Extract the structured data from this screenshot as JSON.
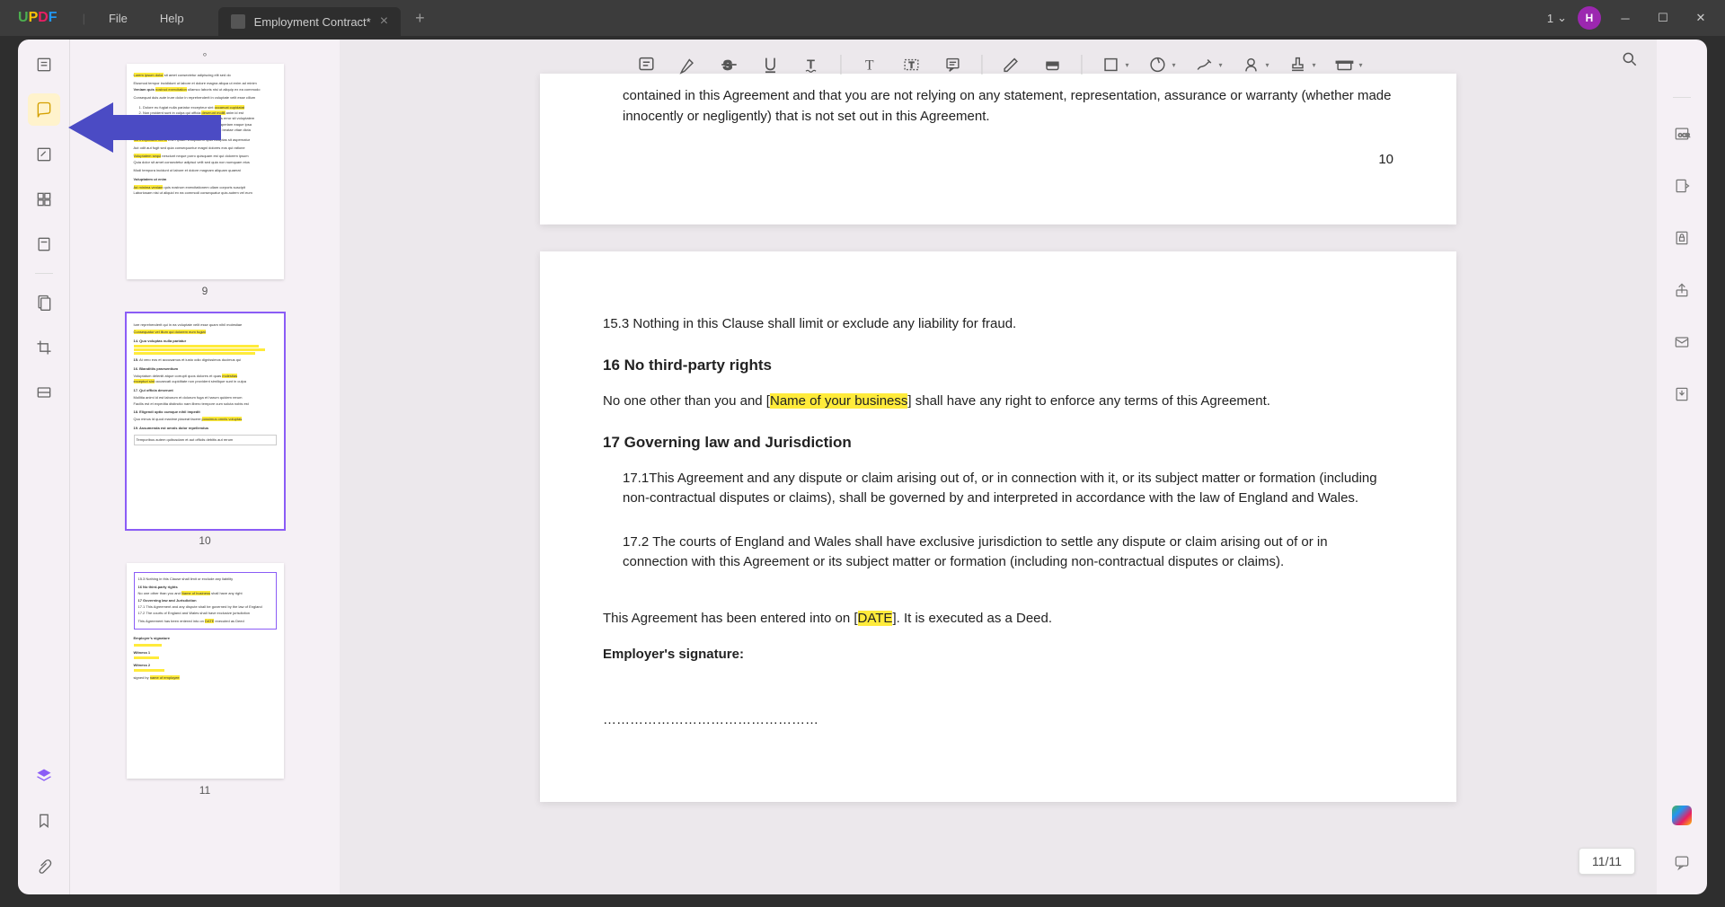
{
  "app": {
    "logo_u": "U",
    "logo_p": "P",
    "logo_d": "D",
    "logo_f": "F"
  },
  "menu": {
    "file": "File",
    "help": "Help"
  },
  "tab": {
    "title": "Employment Contract*",
    "close": "×",
    "add": "+"
  },
  "window": {
    "notif": "1",
    "avatar": "H"
  },
  "thumbs": {
    "p9": "9",
    "p10": "10",
    "p11": "11"
  },
  "page_indicator": "11/11",
  "doc": {
    "p10_frag1": "contained in this Agreement and that you are not relying on any statement, representation, assurance or warranty (whether made innocently or negligently) that is not set out in this Agreement.",
    "p10_num": "10",
    "c153": "15.3   Nothing in this Clause shall limit or exclude any liability for fraud.",
    "h16": "16   No third-party rights",
    "c16_a": "No one other than you and [",
    "c16_hl": "Name of your business",
    "c16_b": "] shall have any right to enforce any terms of this Agreement.",
    "h17": "17   Governing law and Jurisdiction",
    "c171": "17.1This Agreement and any dispute or claim arising out of, or in connection with it, or its subject matter or formation (including non-contractual disputes or claims), shall be governed by and interpreted in accordance with the law of England and Wales.",
    "c172": "17.2 The courts of England and Wales shall have exclusive jurisdiction to settle any dispute or claim arising out of or in connection with this Agreement or its subject matter or formation (including non-contractual disputes or claims).",
    "entered_a": "This Agreement has been entered into on [",
    "entered_hl": "DATE",
    "entered_b": "]. It is executed as a Deed.",
    "sig_label": "Employer's signature:",
    "sig_line": "…………………………………………"
  }
}
